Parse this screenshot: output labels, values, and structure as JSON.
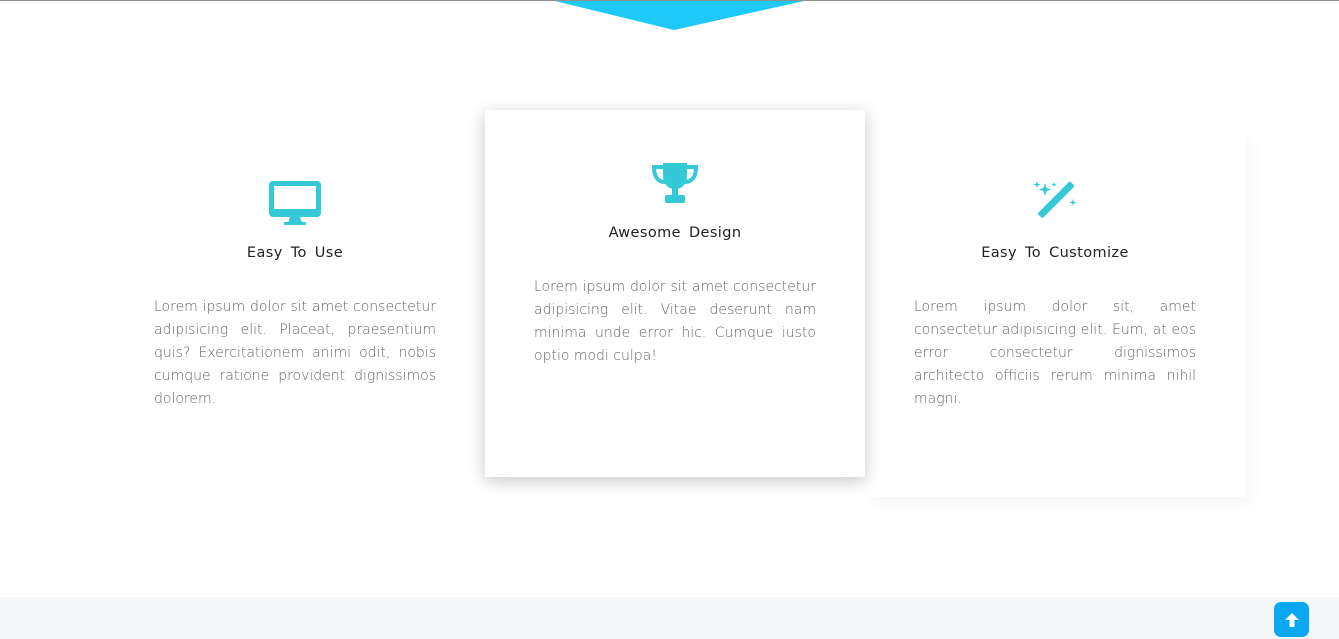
{
  "features": [
    {
      "icon": "monitor-icon",
      "title": "Easy To Use",
      "text": "Lorem ipsum dolor sit amet consectetur adipisicing elit. Placeat, praesentium quis? Exercitationem animi odit, nobis cumque ratione provident dignissimos dolorem."
    },
    {
      "icon": "trophy-icon",
      "title": "Awesome Design",
      "text": "Lorem ipsum dolor sit amet consectetur adipisicing elit. Vitae deserunt nam minima unde error hic. Cumque iusto optio modi culpa!"
    },
    {
      "icon": "magic-wand-icon",
      "title": "Easy To Customize",
      "text": "Lorem ipsum dolor sit, amet consectetur adipisicing elit. Eum, at eos error consectetur dignissimos architecto officiis rerum minima nihil magni."
    }
  ],
  "back_to_top": {
    "icon": "arrow-up-icon"
  },
  "colors": {
    "accent": "#33c9d6",
    "top_arrow": "#1ec8f7",
    "button": "#0aa7f2",
    "footer_bg": "#f5f6f8"
  }
}
